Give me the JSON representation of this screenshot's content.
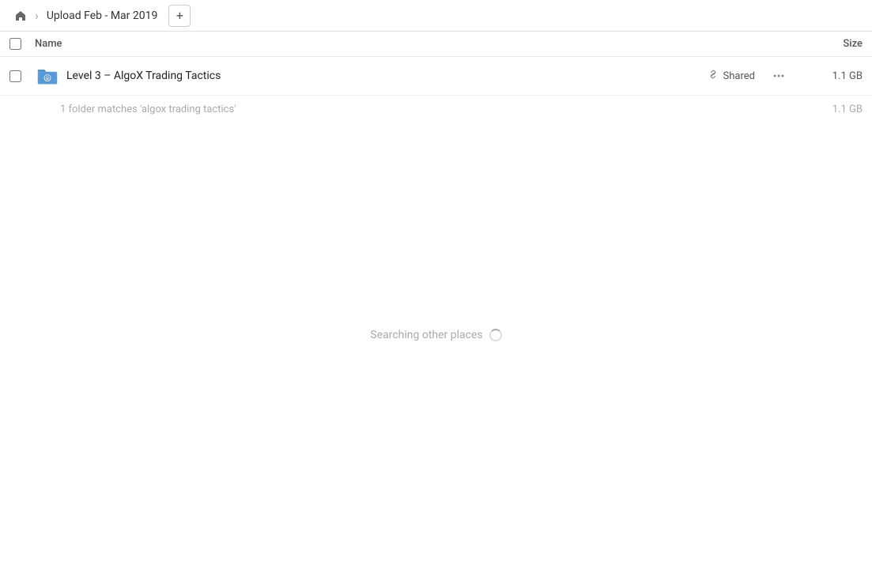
{
  "header": {
    "home_icon": "home-icon",
    "breadcrumb_sep": "›",
    "breadcrumb_title": "Upload Feb - Mar 2019",
    "add_button_label": "+"
  },
  "columns": {
    "name_label": "Name",
    "size_label": "Size"
  },
  "file_row": {
    "name": "Level 3 – AlgoX Trading Tactics",
    "shared_label": "Shared",
    "size": "1.1 GB",
    "more_icon": "•••"
  },
  "matches_row": {
    "text": "1 folder matches 'algox trading tactics'",
    "size": "1.1 GB"
  },
  "searching": {
    "text": "Searching other places"
  }
}
